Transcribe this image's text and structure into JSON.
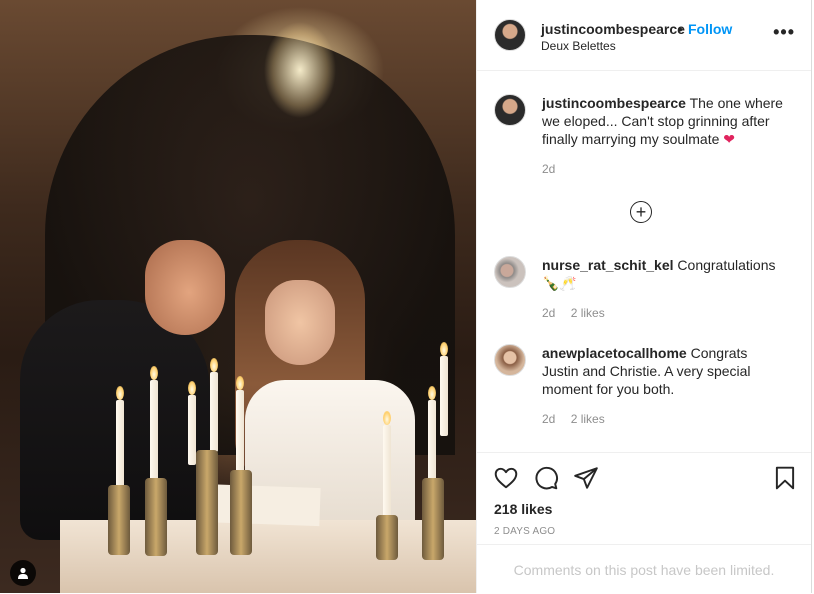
{
  "header": {
    "username": "justincoombespearce",
    "separator": "•",
    "follow_label": "Follow",
    "location": "Deux Belettes",
    "more_icon": "more-options-icon"
  },
  "caption": {
    "username": "justincoombespearce",
    "text": "The one where we eloped... Can't stop grinning after finally marrying my soulmate",
    "emoji": "❤",
    "time": "2d"
  },
  "comments": [
    {
      "username": "nurse_rat_schit_kel",
      "text": "Congratulations 🍾🥂",
      "time": "2d",
      "likes": "2 likes"
    },
    {
      "username": "anewplacetocallhome",
      "text": "Congrats Justin and Christie. A very special moment for you both.",
      "time": "2d",
      "likes": "2 likes"
    }
  ],
  "load_more_icon": "plus-circle-icon",
  "actions": {
    "like_icon": "heart-icon",
    "comment_icon": "comment-icon",
    "share_icon": "paper-plane-icon",
    "save_icon": "bookmark-icon"
  },
  "likes_count": "218 likes",
  "posted_ago": "2 DAYS AGO",
  "comments_limited": "Comments on this post have been limited.",
  "colors": {
    "follow": "#0095f6",
    "muted": "#8e8e8e",
    "heart": "#e0245e"
  }
}
